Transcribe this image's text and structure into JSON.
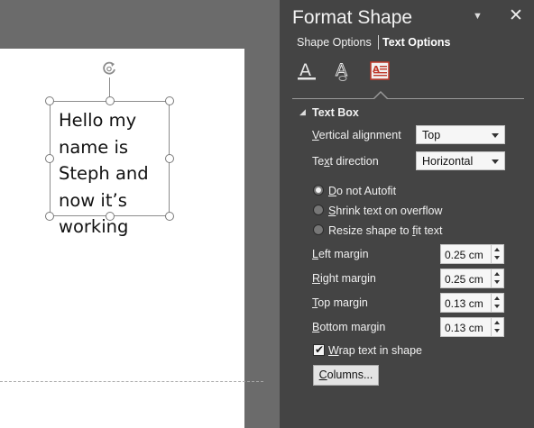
{
  "slide": {
    "textbox_text": "Hello my\nname is\nSteph and\nnow it’s\nworking"
  },
  "panel": {
    "title": "Format Shape",
    "tabs": [
      {
        "label": "Shape Options",
        "active": false
      },
      {
        "label": "Text Options",
        "active": true
      }
    ],
    "icons": [
      "text-fill-outline-icon",
      "text-effects-icon",
      "textbox-icon"
    ],
    "section_title": "Text Box",
    "vertical_alignment": {
      "label_pre": "",
      "label_u": "V",
      "label_post": "ertical alignment",
      "value": "Top"
    },
    "text_direction": {
      "label_pre": "Te",
      "label_u": "x",
      "label_post": "t direction",
      "value": "Horizontal"
    },
    "autofit_options": [
      {
        "pre": "",
        "u": "D",
        "post": "o not Autofit",
        "selected": true
      },
      {
        "pre": "",
        "u": "S",
        "post": "hrink text on overflow",
        "selected": false
      },
      {
        "pre": "Resize shape to ",
        "u": "f",
        "post": "it text",
        "selected": false
      }
    ],
    "margins": [
      {
        "pre": "",
        "u": "L",
        "post": "eft margin",
        "value": "0.25 cm"
      },
      {
        "pre": "",
        "u": "R",
        "post": "ight margin",
        "value": "0.25 cm"
      },
      {
        "pre": "",
        "u": "T",
        "post": "op margin",
        "value": "0.13 cm"
      },
      {
        "pre": "",
        "u": "B",
        "post": "ottom margin",
        "value": "0.13 cm"
      }
    ],
    "wrap": {
      "pre": "",
      "u": "W",
      "post": "rap text in shape",
      "checked": true
    },
    "columns": {
      "pre": "",
      "u": "C",
      "post": "olumns..."
    }
  },
  "colors": {
    "panel_bg": "#444444",
    "workspace_bg": "#6b6b6b",
    "textbox_icon_accent": "#c0392b"
  }
}
